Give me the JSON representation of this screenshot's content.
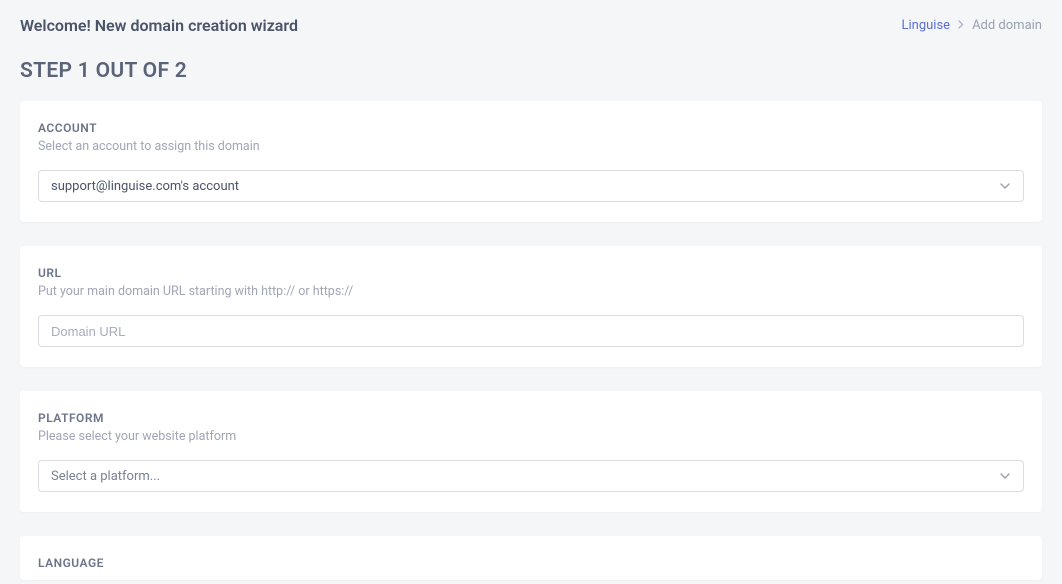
{
  "header": {
    "title": "Welcome! New domain creation wizard",
    "breadcrumb": {
      "link": "Linguise",
      "current": "Add domain"
    }
  },
  "step_title": "STEP 1 OUT OF 2",
  "sections": {
    "account": {
      "label": "ACCOUNT",
      "desc": "Select an account to assign this domain",
      "value": "support@linguise.com's account"
    },
    "url": {
      "label": "URL",
      "desc": "Put your main domain URL starting with http:// or https://",
      "placeholder": "Domain URL"
    },
    "platform": {
      "label": "PLATFORM",
      "desc": "Please select your website platform",
      "value": "Select a platform..."
    },
    "language": {
      "label": "LANGUAGE"
    }
  }
}
